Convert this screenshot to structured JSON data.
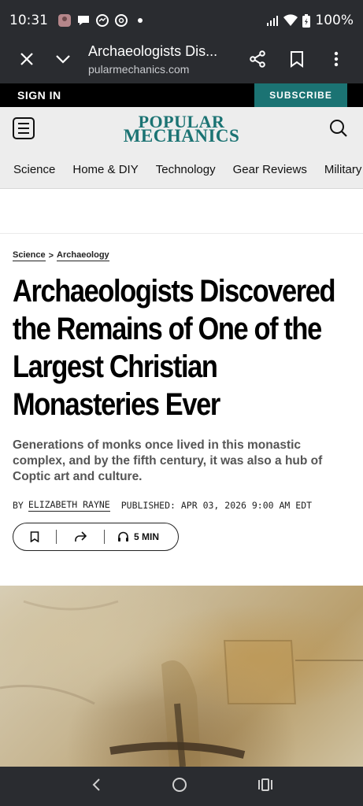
{
  "status_bar": {
    "time": "10:31",
    "battery": "100%"
  },
  "browser": {
    "title": "Archaeologists Dis...",
    "url": "pularmechanics.com"
  },
  "site": {
    "signin_label": "SIGN IN",
    "subscribe_label": "SUBSCRIBE",
    "logo_line1": "POPULAR",
    "logo_line2": "MECHANICS",
    "brand_color": "#1b7373",
    "nav": [
      "Science",
      "Home & DIY",
      "Technology",
      "Gear Reviews",
      "Military"
    ]
  },
  "article": {
    "breadcrumb": {
      "section": "Science",
      "separator": ">",
      "subsection": "Archaeology"
    },
    "headline": "Archaeologists Discovered the Remains of One of the Largest Christian Monasteries Ever",
    "dek": "Generations of monks once lived in this monastic complex, and by the fifth century, it was also a hub of Coptic art and culture.",
    "byline_prefix": "BY",
    "author": "ELIZABETH RAYNE",
    "published": "PUBLISHED: APR 03, 2026 9:00 AM EDT",
    "listen_label": "5 MIN"
  }
}
